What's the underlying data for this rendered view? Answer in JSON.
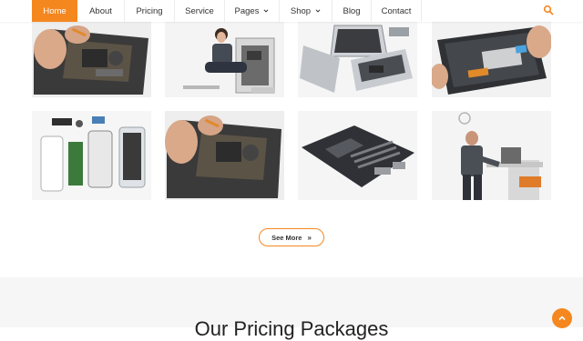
{
  "nav": {
    "items": [
      {
        "label": "Home"
      },
      {
        "label": "About"
      },
      {
        "label": "Pricing"
      },
      {
        "label": "Service"
      },
      {
        "label": "Pages"
      },
      {
        "label": "Shop"
      },
      {
        "label": "Blog"
      },
      {
        "label": "Contact"
      }
    ],
    "search_icon": "search-icon"
  },
  "gallery": {
    "images": [
      {
        "name": "laptop-motherboard-repair"
      },
      {
        "name": "woman-repairing-pc-tower"
      },
      {
        "name": "disassembled-macbook"
      },
      {
        "name": "tablet-battery-replacement"
      },
      {
        "name": "phone-parts-teardown"
      },
      {
        "name": "laptop-motherboard-repair-2"
      },
      {
        "name": "desktop-motherboard"
      },
      {
        "name": "technician-at-desk"
      }
    ]
  },
  "see_more": {
    "label": "See More",
    "arrow": "»"
  },
  "pricing": {
    "title": "Our Pricing Packages"
  },
  "colors": {
    "accent": "#f5871f",
    "text": "#333333",
    "section_bg": "#f6f6f6"
  }
}
